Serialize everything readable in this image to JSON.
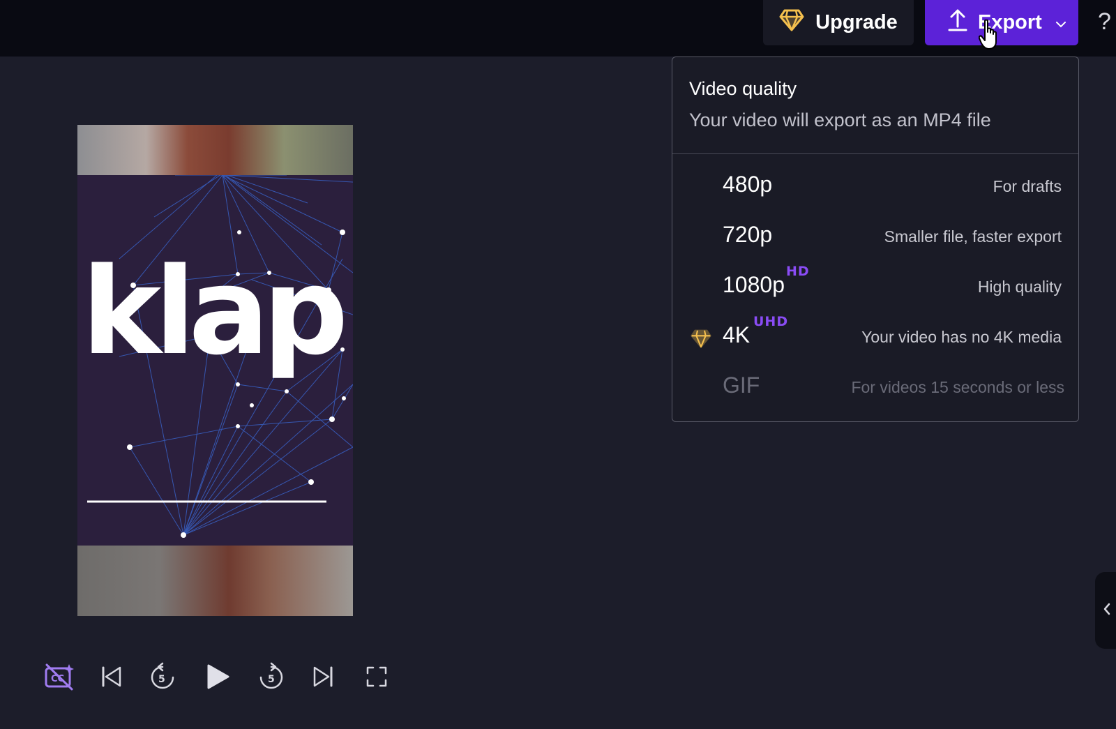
{
  "header": {
    "upgrade_label": "Upgrade",
    "export_label": "Export",
    "help_label": "?"
  },
  "preview": {
    "brand_text": "klap"
  },
  "export_menu": {
    "title": "Video quality",
    "subtitle": "Your video will export as an MP4 file",
    "options": [
      {
        "label": "480p",
        "badge": "",
        "description": "For drafts",
        "premium": false,
        "disabled": false
      },
      {
        "label": "720p",
        "badge": "",
        "description": "Smaller file, faster export",
        "premium": false,
        "disabled": false
      },
      {
        "label": "1080p",
        "badge": "HD",
        "description": "High quality",
        "premium": false,
        "disabled": false
      },
      {
        "label": "4K",
        "badge": "UHD",
        "description": "Your video has no 4K media",
        "premium": true,
        "disabled": false
      },
      {
        "label": "GIF",
        "badge": "",
        "description": "For videos 15 seconds or less",
        "premium": false,
        "disabled": true
      }
    ]
  },
  "colors": {
    "accent": "#5c22d8",
    "badge": "#8a4cf5",
    "gem": "#f5c04e",
    "background": "#1c1d2a",
    "topbar": "#090a12"
  },
  "icons": {
    "upgrade": "gem-icon",
    "export": "upload-icon",
    "dropdown": "chevron-down-icon",
    "captions": "captions-off-icon",
    "skip_start": "skip-to-start-icon",
    "rewind": "rewind-5-icon",
    "play": "play-icon",
    "forward": "forward-5-icon",
    "skip_end": "skip-to-end-icon",
    "fullscreen": "fullscreen-icon",
    "collapse": "chevron-left-icon"
  }
}
